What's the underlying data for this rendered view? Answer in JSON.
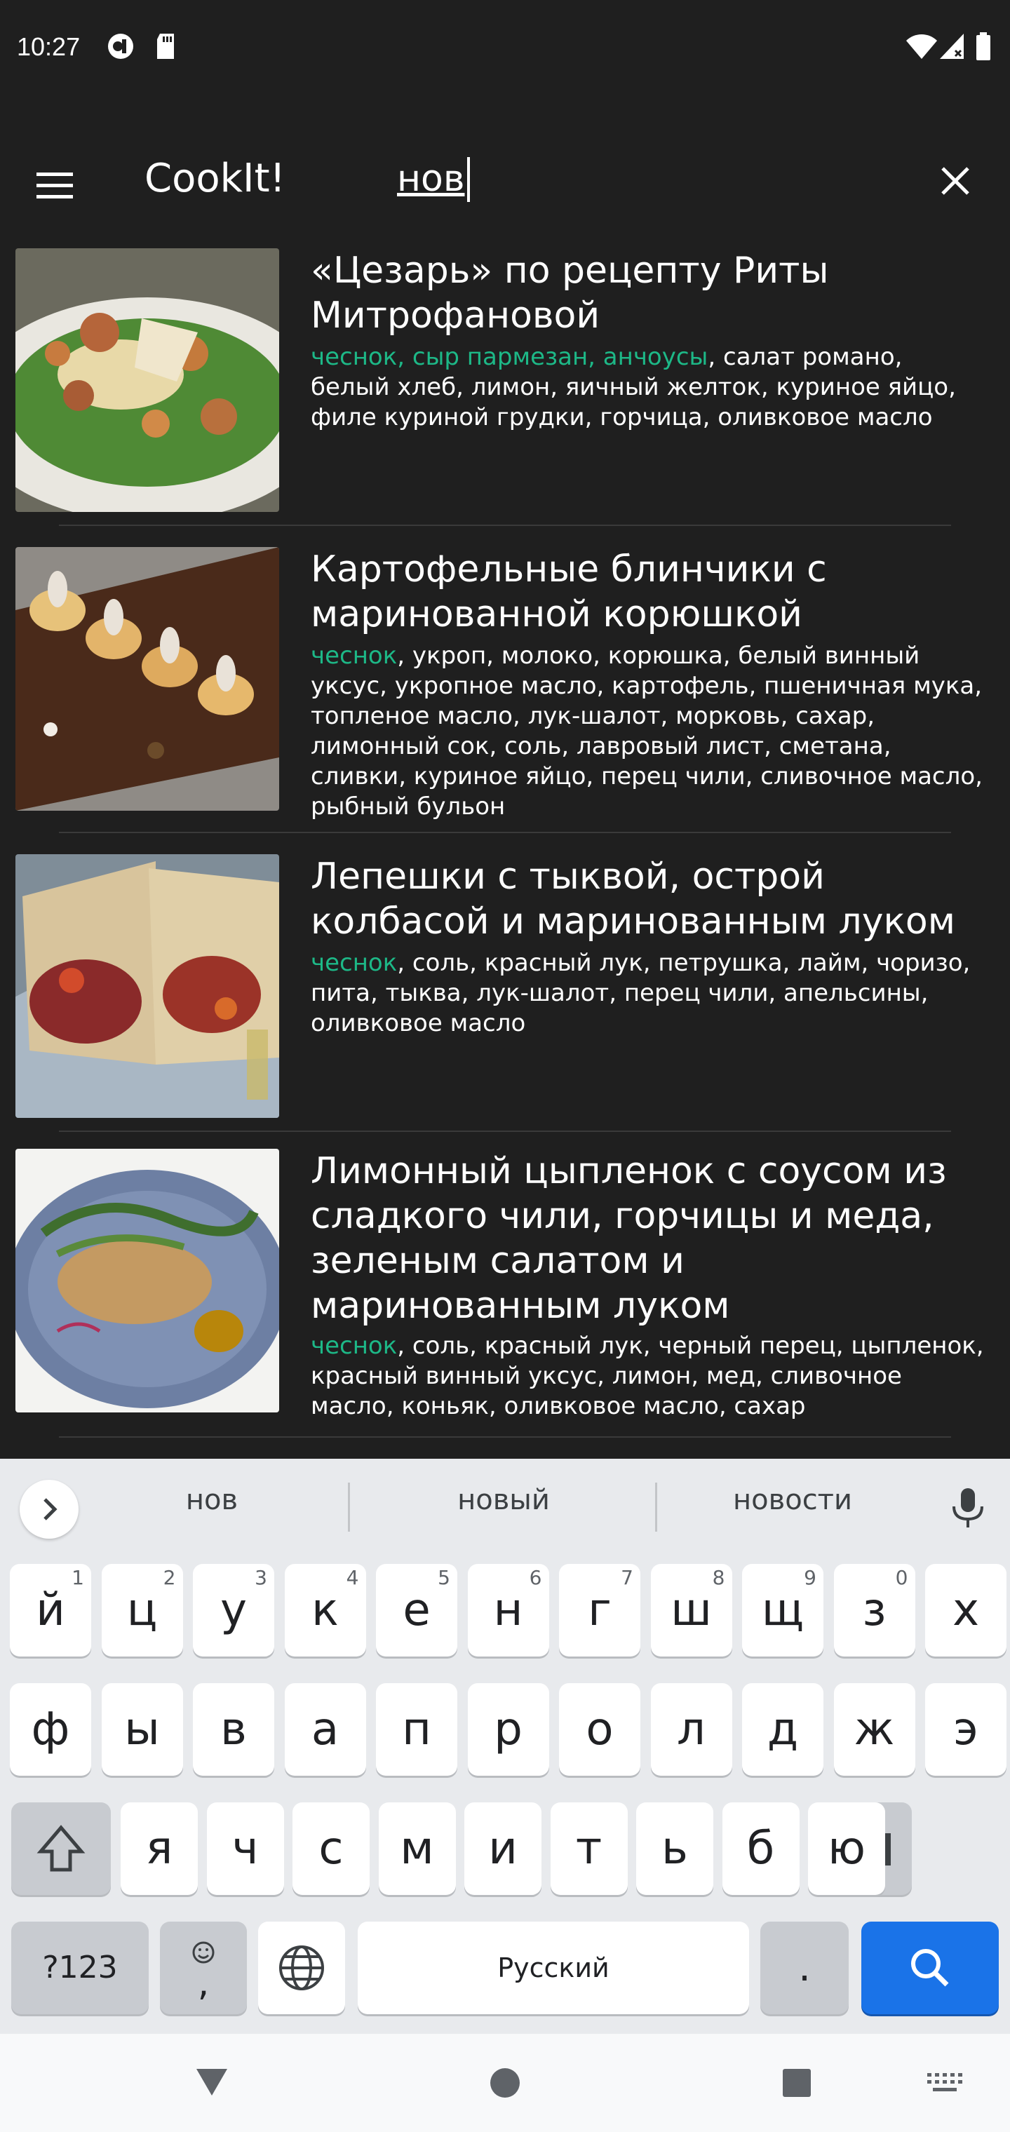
{
  "status_bar": {
    "time": "10:27"
  },
  "app_bar": {
    "title": "CookIt!",
    "search_value": "нов"
  },
  "recipes": [
    {
      "title": "«Цезарь» по рецепту Риты Митрофановой",
      "matched": "чеснок, сыр пармезан, анчоусы",
      "rest": ", салат романо, белый хлеб, лимон, яичный желток, куриное яйцо, филе куриной грудки, горчица, оливковое масло"
    },
    {
      "title": "Картофельные блинчики с маринованной корюшкой",
      "matched": "чеснок",
      "rest": ", укроп, молоко, корюшка, белый винный уксус, укропное масло, картофель, пшеничная мука, топленое масло, лук-шалот, морковь, сахар, лимонный сок, соль, лавровый лист, сметана, сливки, куриное яйцо, перец чили, сливочное масло, рыбный бульон"
    },
    {
      "title": "Лепешки с тыквой, острой колбасой и маринованным луком",
      "matched": "чеснок",
      "rest": ", соль, красный лук, петрушка, лайм, чоризо, пита, тыква, лук-шалот, перец чили, апельсины, оливковое масло"
    },
    {
      "title": "Лимонный цыпленок с соусом из сладкого чили, горчицы и меда, зеленым салатом и маринованным луком",
      "matched": "чеснок",
      "rest": ", соль, красный лук, черный перец, цыпленок, красный винный уксус, лимон, мед, сливочное масло, коньяк, оливковое масло, сахар"
    }
  ],
  "keyboard": {
    "suggestions": [
      "нов",
      "новый",
      "новости"
    ],
    "row1": [
      {
        "k": "й",
        "n": "1"
      },
      {
        "k": "ц",
        "n": "2"
      },
      {
        "k": "у",
        "n": "3"
      },
      {
        "k": "к",
        "n": "4"
      },
      {
        "k": "е",
        "n": "5"
      },
      {
        "k": "н",
        "n": "6"
      },
      {
        "k": "г",
        "n": "7"
      },
      {
        "k": "ш",
        "n": "8"
      },
      {
        "k": "щ",
        "n": "9"
      },
      {
        "k": "з",
        "n": "0"
      },
      {
        "k": "х",
        "n": ""
      }
    ],
    "row2": [
      "ф",
      "ы",
      "в",
      "а",
      "п",
      "р",
      "о",
      "л",
      "д",
      "ж",
      "э"
    ],
    "row3": [
      "я",
      "ч",
      "с",
      "м",
      "и",
      "т",
      "ь",
      "б",
      "ю"
    ],
    "symbols_label": "?123",
    "emoji_comma": ",",
    "space_label": "Русский",
    "period_label": "."
  },
  "colors": {
    "accent": "#1db887",
    "search_key": "#1a73e8",
    "background": "#1f1f1f"
  },
  "icons": [
    "menu-icon",
    "close-icon",
    "mic-icon",
    "globe-icon",
    "search-icon",
    "backspace-icon",
    "shift-icon",
    "back-icon",
    "home-icon",
    "recents-icon",
    "keyboard-switch-icon"
  ]
}
